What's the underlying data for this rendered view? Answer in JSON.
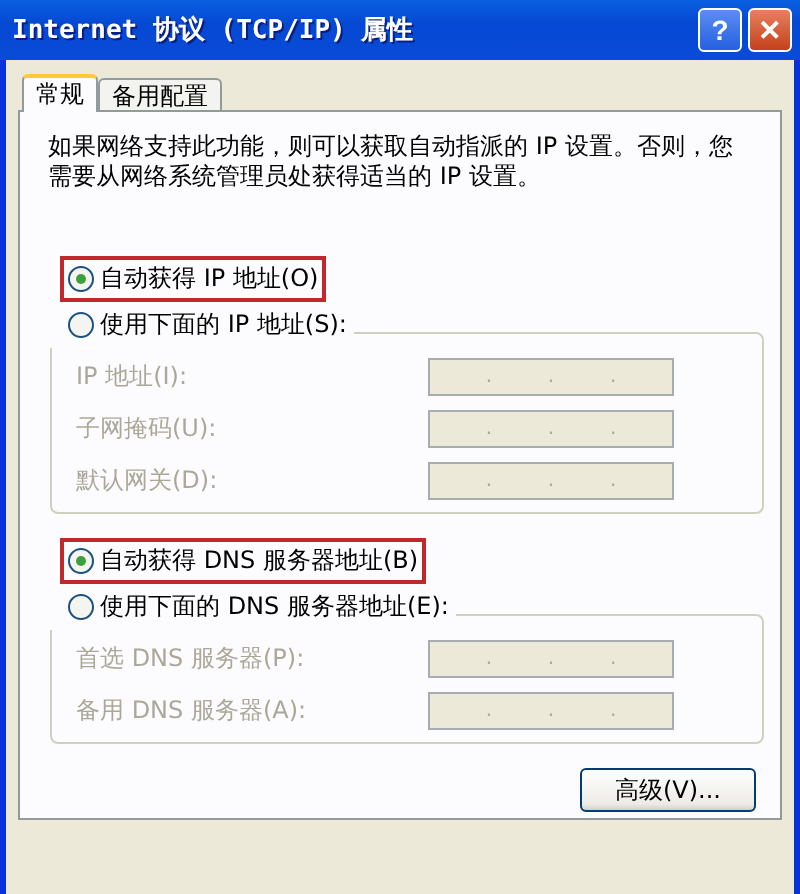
{
  "window": {
    "title": "Internet 协议 (TCP/IP) 属性",
    "buttons": [
      {
        "kind": "help",
        "label": "?"
      },
      {
        "kind": "close",
        "label": "✕"
      }
    ]
  },
  "tabs": [
    {
      "label": "常规",
      "selected": true
    },
    {
      "label": "备用配置",
      "selected": false
    }
  ],
  "description": "如果网络支持此功能，则可以获取自动指派的 IP 设置。否则，您需要从网络系统管理员处获得适当的 IP 设置。",
  "sections": [
    {
      "options": [
        {
          "label": "自动获得 IP 地址(O)",
          "selected": true,
          "highlighted": true
        },
        {
          "label": "使用下面的 IP 地址(S):",
          "selected": false,
          "highlighted": false
        }
      ],
      "fields": [
        {
          "label": "IP 地址(I):",
          "disabled": true,
          "separators": [
            ".",
            ".",
            "."
          ]
        },
        {
          "label": "子网掩码(U):",
          "disabled": true,
          "separators": [
            ".",
            ".",
            "."
          ]
        },
        {
          "label": "默认网关(D):",
          "disabled": true,
          "separators": [
            ".",
            ".",
            "."
          ]
        }
      ]
    },
    {
      "options": [
        {
          "label": "自动获得 DNS 服务器地址(B)",
          "selected": true,
          "highlighted": true
        },
        {
          "label": "使用下面的 DNS 服务器地址(E):",
          "selected": false,
          "highlighted": false
        }
      ],
      "fields": [
        {
          "label": "首选 DNS 服务器(P):",
          "disabled": true,
          "separators": [
            ".",
            ".",
            "."
          ]
        },
        {
          "label": "备用 DNS 服务器(A):",
          "disabled": true,
          "separators": [
            ".",
            ".",
            "."
          ]
        }
      ]
    }
  ],
  "advanced_button": "高级(V)..."
}
